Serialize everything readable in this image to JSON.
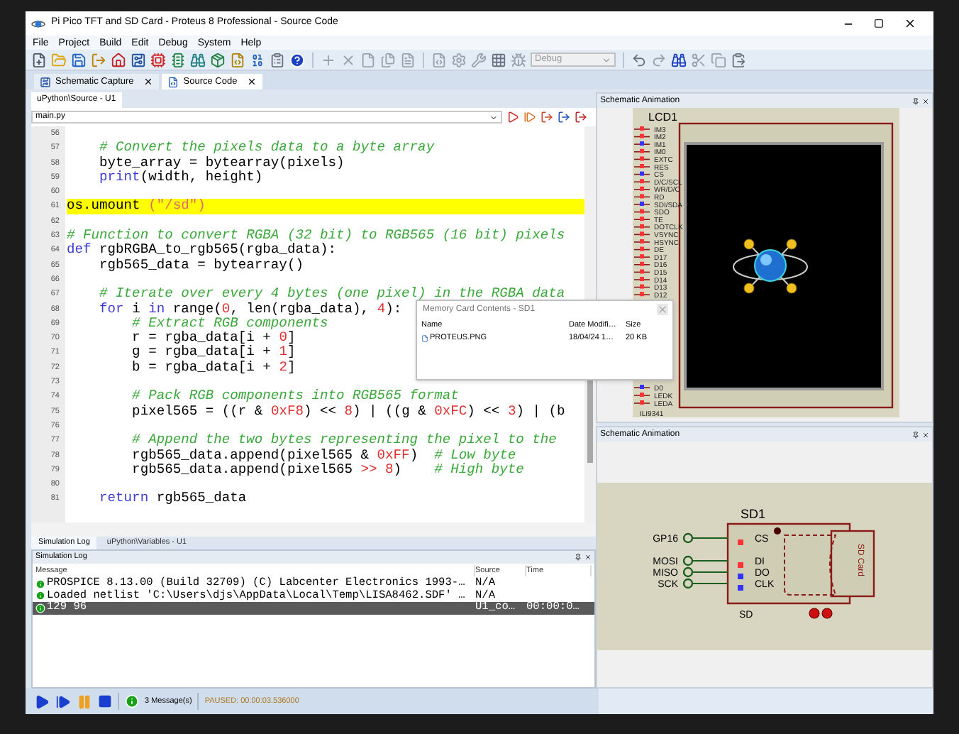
{
  "window": {
    "title": "Pi Pico TFT and SD Card - Proteus 8 Professional - Source Code"
  },
  "menu": [
    "File",
    "Project",
    "Build",
    "Edit",
    "Debug",
    "System",
    "Help"
  ],
  "toolbar": {
    "config_dropdown": {
      "value": "Debug",
      "disabled": true
    }
  },
  "document_tabs": [
    {
      "label": "Schematic Capture",
      "selected": false
    },
    {
      "label": "Source Code",
      "selected": true
    }
  ],
  "editor": {
    "tab": "uPython\\Source - U1",
    "file": "main.py",
    "lines": [
      {
        "number": "56",
        "highlighted": false
      },
      {
        "number": "57",
        "highlighted": false,
        "tokens": [
          {
            "kind": "comment",
            "text": "    # Convert the pixels data to a byte array"
          }
        ]
      },
      {
        "number": "58",
        "highlighted": false,
        "tokens": [
          {
            "kind": "plain",
            "text": "    byte_array = bytearray(pixels)"
          }
        ]
      },
      {
        "number": "59",
        "highlighted": false,
        "tokens": [
          {
            "kind": "keyword",
            "text": "    print"
          },
          {
            "kind": "plain",
            "text": "(width, height)"
          }
        ]
      },
      {
        "number": "60",
        "highlighted": false
      },
      {
        "number": "61",
        "highlighted": true,
        "tokens": [
          {
            "kind": "plain",
            "text": "os.umount "
          },
          {
            "kind": "string",
            "text": "(\"/sd\")"
          }
        ]
      },
      {
        "number": "62",
        "highlighted": false
      },
      {
        "number": "63",
        "highlighted": false,
        "tokens": [
          {
            "kind": "comment",
            "text": "# Function to convert RGBA (32 bit) to RGB565 (16 bit) pixels"
          }
        ]
      },
      {
        "number": "64",
        "highlighted": false,
        "tokens": [
          {
            "kind": "keyword",
            "text": "def"
          },
          {
            "kind": "plain",
            "text": " rgbRGBA_to_rgb565(rgba_data):"
          }
        ]
      },
      {
        "number": "65",
        "highlighted": false,
        "tokens": [
          {
            "kind": "plain",
            "text": "    rgb565_data = bytearray()"
          }
        ]
      },
      {
        "number": "66",
        "highlighted": false
      },
      {
        "number": "67",
        "highlighted": false,
        "tokens": [
          {
            "kind": "comment",
            "text": "    # Iterate over every 4 bytes (one pixel) in the RGBA data"
          }
        ]
      },
      {
        "number": "68",
        "highlighted": false,
        "tokens": [
          {
            "kind": "keyword",
            "text": "    for"
          },
          {
            "kind": "plain",
            "text": " i "
          },
          {
            "kind": "keyword",
            "text": "in"
          },
          {
            "kind": "plain",
            "text": " range("
          },
          {
            "kind": "number",
            "text": "0"
          },
          {
            "kind": "plain",
            "text": ", len(rgba_data), "
          },
          {
            "kind": "number",
            "text": "4"
          },
          {
            "kind": "plain",
            "text": "):"
          }
        ]
      },
      {
        "number": "69",
        "highlighted": false,
        "tokens": [
          {
            "kind": "comment",
            "text": "        # Extract RGB components"
          }
        ]
      },
      {
        "number": "70",
        "highlighted": false,
        "tokens": [
          {
            "kind": "plain",
            "text": "        r = rgba_data[i + "
          },
          {
            "kind": "number",
            "text": "0"
          },
          {
            "kind": "plain",
            "text": "]"
          }
        ]
      },
      {
        "number": "71",
        "highlighted": false,
        "tokens": [
          {
            "kind": "plain",
            "text": "        g = rgba_data[i + "
          },
          {
            "kind": "number",
            "text": "1"
          },
          {
            "kind": "plain",
            "text": "]"
          }
        ]
      },
      {
        "number": "72",
        "highlighted": false,
        "tokens": [
          {
            "kind": "plain",
            "text": "        b = rgba_data[i + "
          },
          {
            "kind": "number",
            "text": "2"
          },
          {
            "kind": "plain",
            "text": "]"
          }
        ]
      },
      {
        "number": "73",
        "highlighted": false
      },
      {
        "number": "74",
        "highlighted": false,
        "tokens": [
          {
            "kind": "comment",
            "text": "        # Pack RGB components into RGB565 format"
          }
        ]
      },
      {
        "number": "75",
        "highlighted": false,
        "tokens": [
          {
            "kind": "plain",
            "text": "        pixel565 = ((r & "
          },
          {
            "kind": "number",
            "text": "0xF8"
          },
          {
            "kind": "plain",
            "text": ") << "
          },
          {
            "kind": "number",
            "text": "8"
          },
          {
            "kind": "plain",
            "text": ") | ((g & "
          },
          {
            "kind": "number",
            "text": "0xFC"
          },
          {
            "kind": "plain",
            "text": ") << "
          },
          {
            "kind": "number",
            "text": "3"
          },
          {
            "kind": "plain",
            "text": ") | (b"
          }
        ]
      },
      {
        "number": "76",
        "highlighted": false
      },
      {
        "number": "77",
        "highlighted": false,
        "tokens": [
          {
            "kind": "comment",
            "text": "        # Append the two bytes representing the pixel to the"
          }
        ]
      },
      {
        "number": "78",
        "highlighted": false,
        "tokens": [
          {
            "kind": "plain",
            "text": "        rgb565_data.append(pixel565 & "
          },
          {
            "kind": "number",
            "text": "0xFF"
          },
          {
            "kind": "plain",
            "text": ")  "
          },
          {
            "kind": "comment",
            "text": "# Low byte"
          }
        ]
      },
      {
        "number": "79",
        "highlighted": false,
        "tokens": [
          {
            "kind": "plain",
            "text": "        rgb565_data.append(pixel565 "
          },
          {
            "kind": "number",
            "text": ">> 8"
          },
          {
            "kind": "plain",
            "text": ")    "
          },
          {
            "kind": "comment",
            "text": "# High byte"
          }
        ]
      },
      {
        "number": "80",
        "highlighted": false
      },
      {
        "number": "81",
        "highlighted": false,
        "tokens": [
          {
            "kind": "keyword",
            "text": "    return"
          },
          {
            "kind": "plain",
            "text": " rgb565_data"
          }
        ]
      }
    ]
  },
  "memory_card_dialog": {
    "title": "Memory Card Contents - SD1",
    "columns": [
      "Name",
      "Date Modifi…",
      "Size"
    ],
    "rows": [
      {
        "name": "PROTEUS.PNG",
        "date": "18/04/24 1…",
        "size": "20 KB"
      }
    ]
  },
  "lcd_panel": {
    "title": "Schematic Animation",
    "part": "LCD1",
    "chip": "ILI9341",
    "left_pins": [
      {
        "label": "IM3",
        "color": "#ff3333"
      },
      {
        "label": "IM2",
        "color": "#ff3333"
      },
      {
        "label": "IM1",
        "color": "#3333ff"
      },
      {
        "label": "IM0",
        "color": "#ff3333"
      },
      {
        "label": "EXTC",
        "color": "#ff3333"
      },
      {
        "label": "RES",
        "color": "#ff3333"
      },
      {
        "label": "CS",
        "color": "#3333ff"
      },
      {
        "label": "D/C/SCL",
        "color": "#ff3333"
      },
      {
        "label": "WR/D/C",
        "color": "#ff3333"
      },
      {
        "label": "RD",
        "color": "#ff3333"
      },
      {
        "label": "SDI/SDA",
        "color": "#3333ff"
      },
      {
        "label": "SDO",
        "color": "#ff3333"
      },
      {
        "label": "TE",
        "color": "#ff3333"
      },
      {
        "label": "DOTCLK",
        "color": "#ff3333"
      },
      {
        "label": "VSYNC",
        "color": "#ff3333"
      },
      {
        "label": "HSYNC",
        "color": "#ff3333"
      },
      {
        "label": "DE",
        "color": "#ff3333"
      },
      {
        "label": "D17",
        "color": "#ff3333"
      },
      {
        "label": "D16",
        "color": "#ff3333"
      },
      {
        "label": "D15",
        "color": "#ff3333"
      },
      {
        "label": "D14",
        "color": "#ff3333"
      },
      {
        "label": "D13",
        "color": "#ff3333"
      },
      {
        "label": "D12",
        "color": "#ff3333"
      }
    ],
    "lower_pins": [
      {
        "label": "D0",
        "color": "#3333ff"
      },
      {
        "label": "LEDK",
        "color": "#ff3333"
      },
      {
        "label": "LEDA",
        "color": "#ff3333"
      }
    ]
  },
  "sd_panel": {
    "title": "Schematic Animation",
    "part": "SD1",
    "type": "SD",
    "card_label": "SD Card",
    "nets": [
      {
        "terminal": "GP16",
        "pin": "CS",
        "color": "#ff3333"
      },
      {
        "terminal": "MOSI",
        "pin": "DI",
        "color": "#ff3333"
      },
      {
        "terminal": "MISO",
        "pin": "DO",
        "color": "#3333ff"
      },
      {
        "terminal": "SCK",
        "pin": "CLK",
        "color": "#3333ff"
      }
    ]
  },
  "bottom_tabs": [
    {
      "label": "Simulation Log",
      "selected": true
    },
    {
      "label": "uPython\\Variables - U1",
      "selected": false
    }
  ],
  "log": {
    "title": "Simulation Log",
    "columns": [
      "Message",
      "Source",
      "Time"
    ],
    "rows": [
      {
        "message": "PROSPICE 8.13.00 (Build 32709) (C) Labcenter Electronics 1993-…",
        "source": "N/A",
        "selected": false
      },
      {
        "message": "Loaded netlist 'C:\\Users\\djs\\AppData\\Local\\Temp\\LISA8462.SDF' …",
        "source": "N/A",
        "selected": false
      },
      {
        "message": "129 96",
        "source": "U1_co…",
        "time": "00:00:0…",
        "selected": true
      }
    ]
  },
  "status": {
    "messages": "3 Message(s)",
    "state": "PAUSED: 00:00:03.536000"
  }
}
